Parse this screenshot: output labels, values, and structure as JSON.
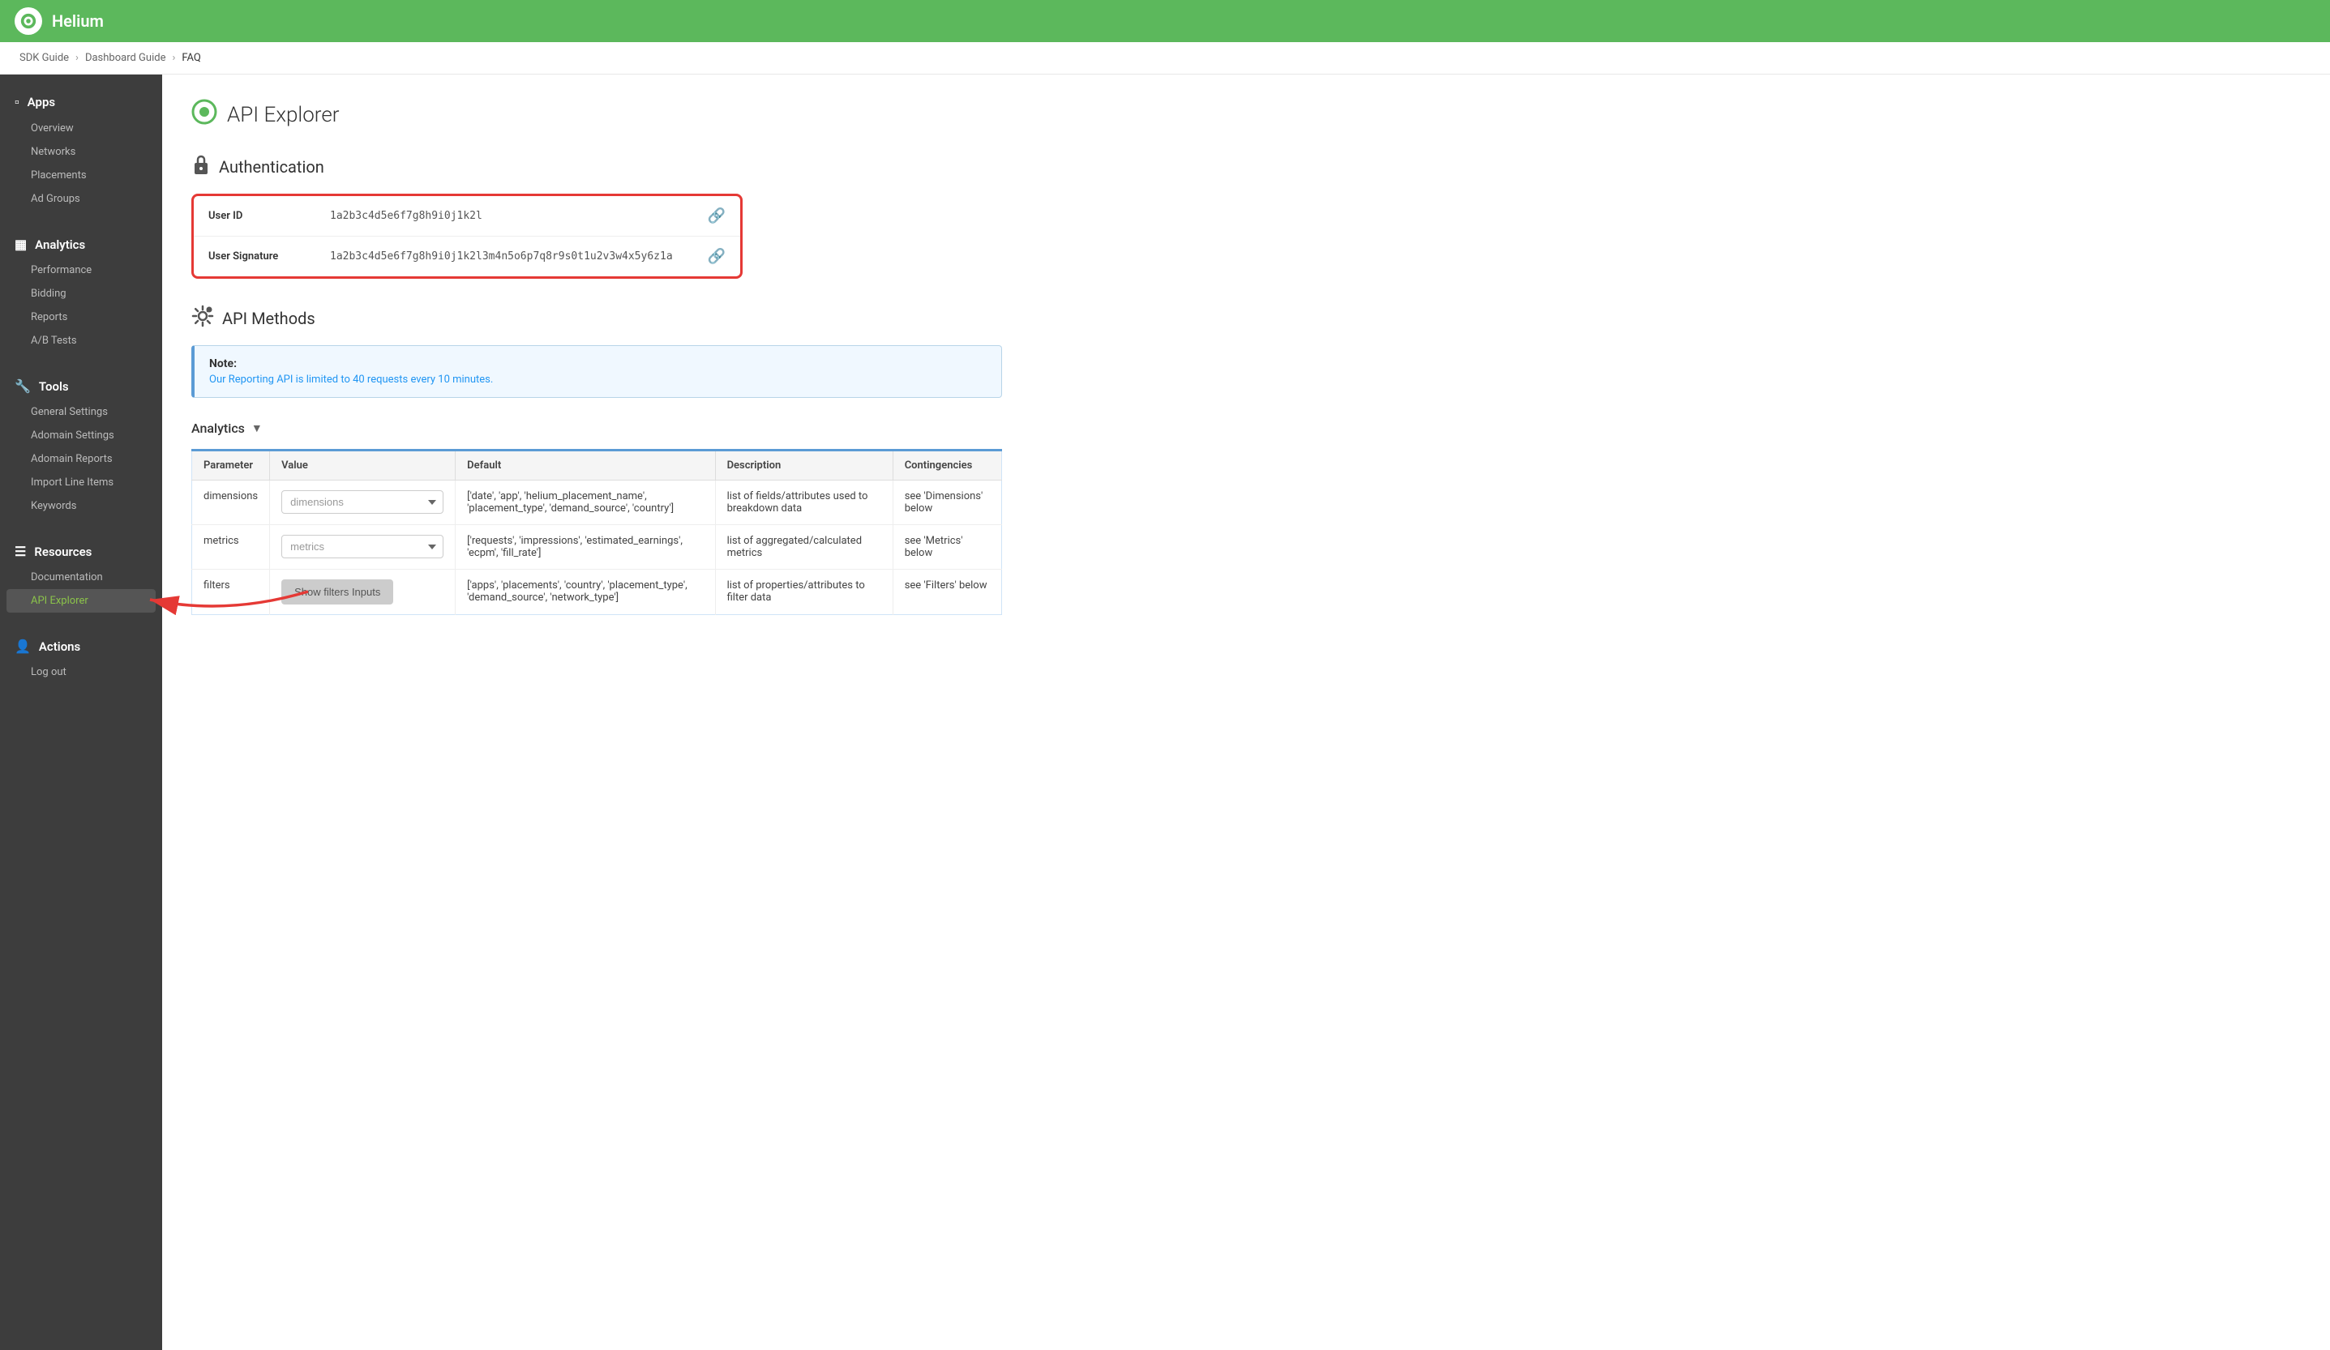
{
  "topbar": {
    "title": "Helium"
  },
  "breadcrumb": {
    "items": [
      "SDK Guide",
      "Dashboard Guide",
      "FAQ"
    ]
  },
  "sidebar": {
    "sections": [
      {
        "id": "apps",
        "icon": "📱",
        "label": "Apps",
        "items": [
          "Overview",
          "Networks",
          "Placements",
          "Ad Groups"
        ]
      },
      {
        "id": "analytics",
        "icon": "📊",
        "label": "Analytics",
        "items": [
          "Performance",
          "Bidding",
          "Reports",
          "A/B Tests"
        ]
      },
      {
        "id": "tools",
        "icon": "🔧",
        "label": "Tools",
        "items": [
          "General Settings",
          "Adomain Settings",
          "Adomain Reports",
          "Import Line Items",
          "Keywords"
        ]
      },
      {
        "id": "resources",
        "icon": "☰",
        "label": "Resources",
        "items": [
          "Documentation",
          "API Explorer"
        ]
      },
      {
        "id": "actions",
        "icon": "👤",
        "label": "Actions",
        "items": [
          "Log out"
        ]
      }
    ]
  },
  "page": {
    "title": "API Explorer",
    "title_icon": "⬤",
    "sections": {
      "authentication": {
        "title": "Authentication",
        "icon": "🔒",
        "user_id_label": "User ID",
        "user_id_value": "1a2b3c4d5e6f7g8h9i0j1k2l",
        "user_signature_label": "User Signature",
        "user_signature_value": "1a2b3c4d5e6f7g8h9i0j1k2l3m4n5o6p7q8r9s0t1u2v3w4x5y6z1a"
      },
      "api_methods": {
        "title": "API Methods",
        "icon": "⚙",
        "note_title": "Note:",
        "note_text": "Our Reporting API is limited to 40 requests every 10 minutes.",
        "analytics_dropdown_label": "Analytics",
        "table_headers": [
          "Parameter",
          "Value",
          "Default",
          "Description",
          "Contingencies"
        ],
        "table_rows": [
          {
            "parameter": "dimensions",
            "value_placeholder": "dimensions",
            "default": "['date', 'app', 'helium_placement_name', 'placement_type', 'demand_source', 'country']",
            "description": "list of fields/attributes used to breakdown data",
            "contingencies": "see 'Dimensions' below"
          },
          {
            "parameter": "metrics",
            "value_placeholder": "metrics",
            "default": "['requests', 'impressions', 'estimated_earnings', 'ecpm', 'fill_rate']",
            "description": "list of aggregated/calculated metrics",
            "contingencies": "see 'Metrics' below"
          },
          {
            "parameter": "filters",
            "value_placeholder": "",
            "value_button": "Show filters Inputs",
            "default": "['apps', 'placements', 'country', 'placement_type', 'demand_source', 'network_type']",
            "description": "list of properties/attributes to filter data",
            "contingencies": "see 'Filters' below"
          }
        ]
      }
    }
  }
}
